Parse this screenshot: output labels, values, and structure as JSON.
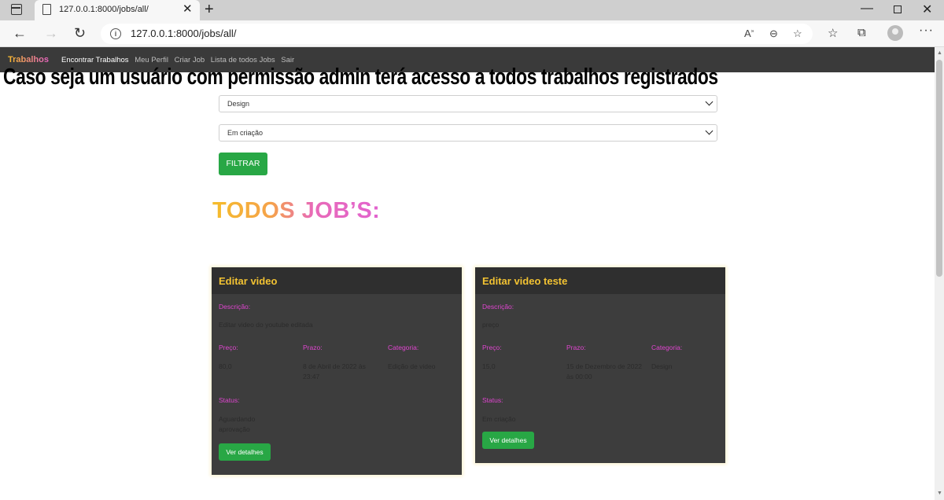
{
  "browser": {
    "tab_title": "127.0.0.1:8000/jobs/all/",
    "tab_close": "✕",
    "new_tab": "+",
    "url": "127.0.0.1:8000/jobs/all/",
    "read_aloud": "A",
    "read_aloud_sup": "»"
  },
  "navbar": {
    "brand": "Trabalhos",
    "links": [
      "Encontrar Trabalhos",
      "Meu Perfil",
      "Criar Job",
      "Lista de todos Jobs",
      "Sair"
    ]
  },
  "caption": "Caso seja um usuário com permissão admin terá acesso a todos trabalhos registrados",
  "filters": {
    "category_selected": "Design",
    "status_selected": "Em criação",
    "submit_label": "FILTRAR"
  },
  "heading": "TODOS JOB’S:",
  "labels": {
    "description": "Descrição:",
    "price": "Preço:",
    "deadline": "Prazo:",
    "category": "Categoria:",
    "status": "Status:",
    "details_button": "Ver detalhes"
  },
  "jobs": [
    {
      "title": "Editar video",
      "description": "Editar video do youtube editada",
      "price": "80,0",
      "deadline": "8 de Abril de 2022 às 23:47",
      "category": "Edição de video",
      "status": "Aguardando aprovação"
    },
    {
      "title": "Editar video teste",
      "description": "preço",
      "price": "15,0",
      "deadline": "15 de Dezembro de 2022 às 00:00",
      "category": "Design",
      "status": "Em criação"
    }
  ],
  "colors": {
    "accent_green": "#28a745",
    "card_title": "#f2c232",
    "label_magenta": "#e045d0",
    "card_bg": "#3d3d3d"
  }
}
